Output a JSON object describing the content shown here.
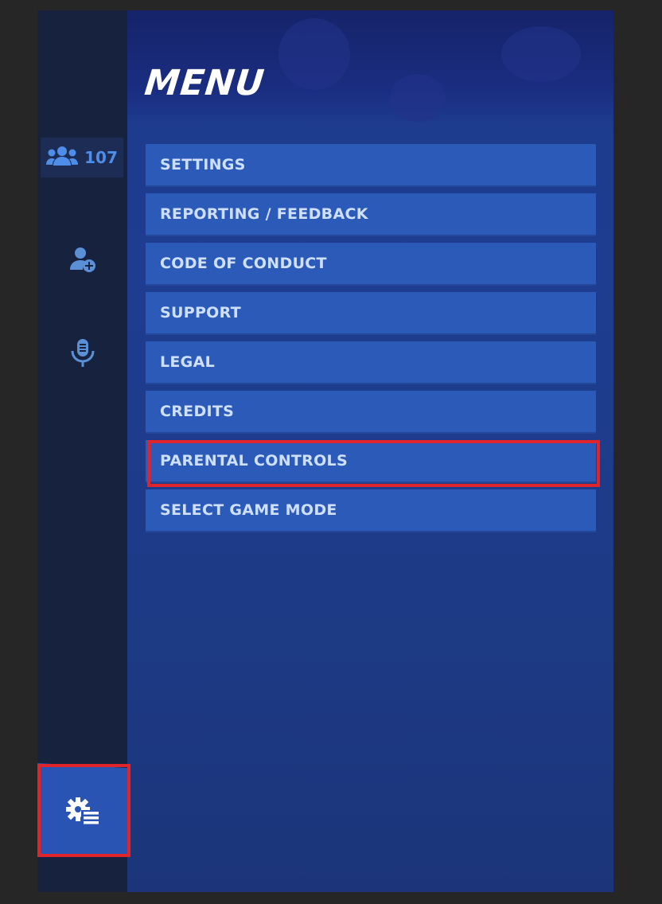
{
  "sidebar": {
    "friends_count": "107",
    "icons": [
      "friends-icon",
      "add-friend-icon",
      "microphone-icon",
      "settings-menu-icon"
    ]
  },
  "header": {
    "title": "MENU"
  },
  "menu": {
    "items": [
      {
        "label": "SETTINGS"
      },
      {
        "label": "REPORTING / FEEDBACK"
      },
      {
        "label": "CODE OF CONDUCT"
      },
      {
        "label": "SUPPORT"
      },
      {
        "label": "LEGAL"
      },
      {
        "label": "CREDITS"
      },
      {
        "label": "PARENTAL CONTROLS",
        "highlighted": true
      },
      {
        "label": "SELECT GAME MODE"
      }
    ]
  },
  "colors": {
    "accent": "#2b5ab8",
    "highlight": "#e0242c",
    "sidebar": "#17223f"
  }
}
